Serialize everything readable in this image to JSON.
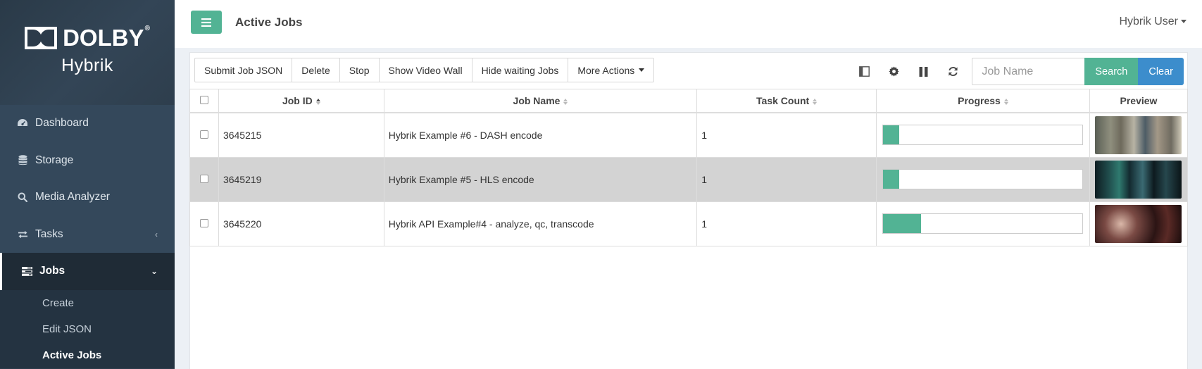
{
  "sidebar": {
    "brand": {
      "logo_text": "DOLBY",
      "registered": "®",
      "product": "Hybrik"
    },
    "items": [
      {
        "label": "Dashboard",
        "icon": "dashboard-icon"
      },
      {
        "label": "Storage",
        "icon": "database-icon"
      },
      {
        "label": "Media Analyzer",
        "icon": "search-icon"
      },
      {
        "label": "Tasks",
        "icon": "exchange-icon",
        "chevron": "‹"
      },
      {
        "label": "Jobs",
        "icon": "tasks-icon",
        "chevron": "⌄"
      }
    ],
    "sub_items": [
      {
        "label": "Create"
      },
      {
        "label": "Edit JSON"
      },
      {
        "label": "Active Jobs"
      }
    ]
  },
  "header": {
    "title": "Active Jobs",
    "user": "Hybrik User"
  },
  "toolbar": {
    "buttons": [
      {
        "label": "Submit Job JSON"
      },
      {
        "label": "Delete"
      },
      {
        "label": "Stop"
      },
      {
        "label": "Show Video Wall"
      },
      {
        "label": "Hide waiting Jobs"
      },
      {
        "label": "More Actions"
      }
    ],
    "search": {
      "placeholder": "Job Name",
      "value": "",
      "search_label": "Search",
      "clear_label": "Clear"
    }
  },
  "table": {
    "columns": [
      "Job ID",
      "Job Name",
      "Task Count",
      "Progress",
      "Preview"
    ],
    "rows": [
      {
        "id": "3645215",
        "name": "Hybrik Example #6 - DASH encode",
        "task_count": "1",
        "progress": 0.08
      },
      {
        "id": "3645219",
        "name": "Hybrik Example #5 - HLS encode",
        "task_count": "1",
        "progress": 0.08
      },
      {
        "id": "3645220",
        "name": "Hybrik API Example#4 - analyze, qc, transcode",
        "task_count": "1",
        "progress": 0.19
      }
    ]
  },
  "colors": {
    "accent": "#52b394",
    "clear": "#3c8dcc",
    "sidebar": "#2c3b4a"
  }
}
